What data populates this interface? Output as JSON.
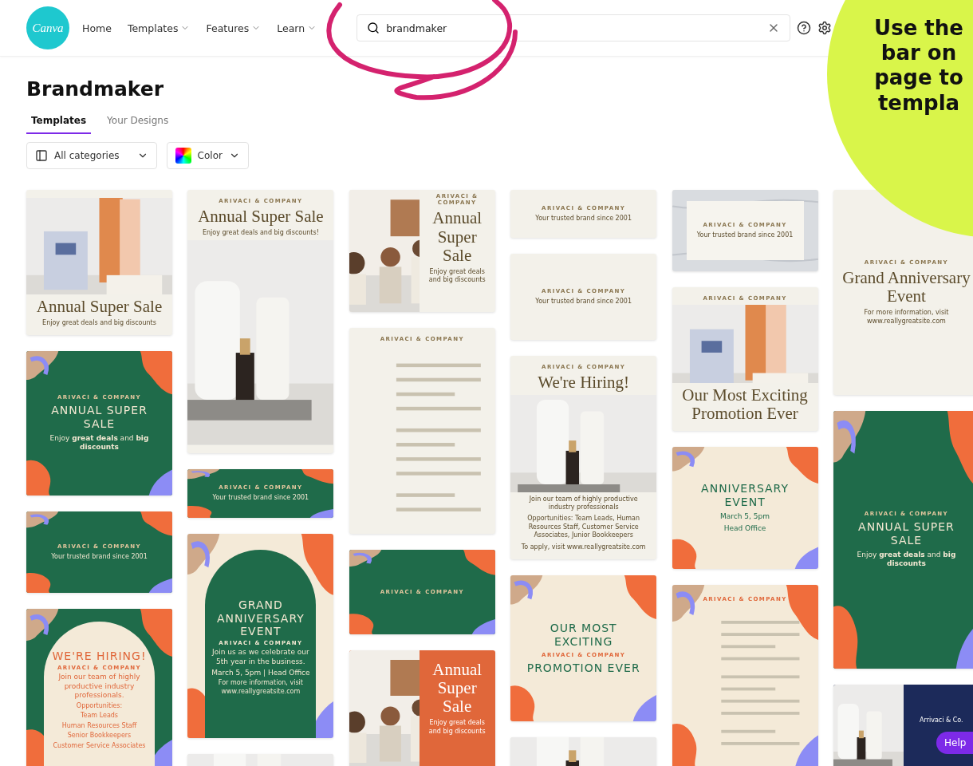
{
  "nav": {
    "logo": "Canva",
    "links": [
      {
        "label": "Home",
        "dropdown": false
      },
      {
        "label": "Templates",
        "dropdown": true
      },
      {
        "label": "Features",
        "dropdown": true
      },
      {
        "label": "Learn",
        "dropdown": true
      }
    ],
    "search": {
      "value": "brandmaker"
    }
  },
  "page": {
    "title": "Brandmaker",
    "tabs": [
      {
        "label": "Templates",
        "selected": true
      },
      {
        "label": "Your Designs",
        "selected": false
      }
    ],
    "filters": [
      {
        "kind": "category",
        "label": "All categories"
      },
      {
        "kind": "color",
        "label": "Color"
      }
    ]
  },
  "columns": [
    [
      {
        "kind": "plain",
        "color": "#f3f1ea",
        "content": [
          {
            "kind": "picture"
          },
          {
            "kind": "title",
            "text": "Annual Super Sale"
          },
          {
            "kind": "body",
            "text": "Enjoy great deals and big discounts"
          }
        ]
      },
      {
        "kind": "blobs",
        "color": "#1f6b4a",
        "content": [
          {
            "kind": "brand",
            "text": "ARIVACI & COMPANY"
          },
          {
            "kind": "arc",
            "text": "ANNUAL SUPER SALE"
          },
          {
            "kind": "subtitle",
            "text": "Enjoy **great deals** and **big discounts**"
          }
        ]
      },
      {
        "kind": "blobs",
        "color": "#1f6b4a",
        "content": [
          {
            "kind": "brand",
            "text": "ARIVACI & COMPANY"
          },
          {
            "kind": "body",
            "text": "Your trusted brand since 2001"
          }
        ]
      },
      {
        "kind": "arch",
        "color": "#1f6b4a",
        "content": [
          {
            "kind": "arc",
            "text": "WE'RE HIRING!"
          },
          {
            "kind": "brand",
            "text": "ARIVACI & COMPANY"
          },
          {
            "kind": "subtitle",
            "text": "Join our team of highly productive industry professionals."
          },
          {
            "kind": "body",
            "text": "Opportunities:"
          },
          {
            "kind": "body",
            "text": "Team Leads"
          },
          {
            "kind": "body",
            "text": "Human Resources Staff"
          },
          {
            "kind": "body",
            "text": "Senior Bookkeepers"
          },
          {
            "kind": "body",
            "text": "Customer Service Associates"
          }
        ]
      }
    ],
    [
      {
        "kind": "plain",
        "color": "#f3f1ea",
        "content": [
          {
            "kind": "brand",
            "text": "ARIVACI & COMPANY"
          },
          {
            "kind": "title",
            "text": "Annual Super Sale"
          },
          {
            "kind": "body",
            "text": "Enjoy great deals and big discounts!"
          },
          {
            "kind": "picture"
          }
        ]
      },
      {
        "kind": "blobs",
        "color": "#1f6b4a",
        "content": [
          {
            "kind": "brand",
            "text": "ARIVACI & COMPANY"
          },
          {
            "kind": "body",
            "text": "Your trusted brand since 2001"
          }
        ]
      },
      {
        "kind": "arch",
        "color": "#f4ead8",
        "content": [
          {
            "kind": "arc",
            "text": "GRAND ANNIVERSARY EVENT"
          },
          {
            "kind": "brand",
            "text": "ARIVACI & COMPANY"
          },
          {
            "kind": "subtitle",
            "text": "Join us as we celebrate our 5th year in the business."
          },
          {
            "kind": "subtitle",
            "text": "March 5, 5pm | Head Office"
          },
          {
            "kind": "body",
            "text": "For more information, visit www.reallygreatsite.com"
          }
        ]
      },
      {
        "content": [
          {
            "kind": "picture"
          }
        ]
      }
    ],
    [
      {
        "kind": "sidephoto",
        "color": "#f3f1ea",
        "content": [
          {
            "kind": "brand",
            "text": "ARIVACI & COMPANY"
          },
          {
            "kind": "title",
            "text": "Annual Super Sale"
          },
          {
            "kind": "body",
            "text": "Enjoy great deals and big discounts"
          }
        ]
      },
      {
        "kind": "plain",
        "color": "#f3f1ea",
        "content": [
          {
            "kind": "brand",
            "text": "ARIVACI & COMPANY"
          },
          {
            "kind": "lines"
          }
        ]
      },
      {
        "kind": "blobs",
        "color": "#1f6b4a",
        "content": [
          {
            "kind": "brand",
            "text": "ARIVACI & COMPANY"
          }
        ]
      },
      {
        "kind": "sidephoto",
        "color": "#e0673a",
        "content": [
          {
            "kind": "title",
            "text": "Annual Super Sale"
          },
          {
            "kind": "body",
            "text": "Enjoy great deals and big discounts"
          }
        ]
      }
    ],
    [
      {
        "kind": "plain",
        "color": "#f3f1ea",
        "content": [
          {
            "kind": "brand",
            "text": "ARIVACI & COMPANY"
          },
          {
            "kind": "body",
            "text": "Your trusted brand since 2001"
          }
        ]
      },
      {
        "kind": "plain",
        "color": "#f3f1ea",
        "content": [
          {
            "kind": "brand",
            "text": "ARIVACI & COMPANY"
          },
          {
            "kind": "body",
            "text": "Your trusted brand since 2001"
          }
        ]
      },
      {
        "kind": "plain",
        "color": "#f3f1ea",
        "content": [
          {
            "kind": "brand",
            "text": "ARIVACI & COMPANY"
          },
          {
            "kind": "title",
            "text": "We're Hiring!"
          },
          {
            "kind": "picture"
          },
          {
            "kind": "body",
            "text": "Join our team of highly productive industry professionals"
          },
          {
            "kind": "body",
            "text": "Opportunities: Team Leads, Human Resources Staff, Customer Service Associates, Junior Bookkeepers"
          },
          {
            "kind": "body",
            "text": "To apply, visit www.reallygreatsite.com"
          }
        ]
      },
      {
        "kind": "blobs",
        "color": "#f4ead8",
        "content": [
          {
            "kind": "arc",
            "text": "OUR MOST EXCITING"
          },
          {
            "kind": "brand",
            "text": "ARIVACI & COMPANY"
          },
          {
            "kind": "arc",
            "text": "PROMOTION EVER"
          }
        ]
      },
      {
        "content": [
          {
            "kind": "picture"
          }
        ]
      }
    ],
    [
      {
        "kind": "marble",
        "color": "#f3f1ea",
        "content": [
          {
            "kind": "brand",
            "text": "ARIVACI & COMPANY"
          },
          {
            "kind": "body",
            "text": "Your trusted brand since 2001"
          }
        ]
      },
      {
        "kind": "plain",
        "color": "#f3f1ea",
        "content": [
          {
            "kind": "brand",
            "text": "ARIVACI & COMPANY"
          },
          {
            "kind": "picture"
          },
          {
            "kind": "title",
            "text": "Our Most Exciting Promotion Ever"
          }
        ]
      },
      {
        "kind": "blobs",
        "color": "#f4ead8",
        "content": [
          {
            "kind": "arc",
            "text": "ANNIVERSARY EVENT"
          },
          {
            "kind": "subtitle",
            "text": "March 5, 5pm"
          },
          {
            "kind": "subtitle",
            "text": "Head Office"
          }
        ]
      },
      {
        "kind": "blobs",
        "color": "#f4ead8",
        "content": [
          {
            "kind": "brand",
            "text": "ARIVACI & COMPANY"
          },
          {
            "kind": "lines"
          }
        ]
      }
    ],
    [
      {
        "kind": "plain",
        "color": "#f3f1ea",
        "content": [
          {
            "kind": "brand",
            "text": "ARIVACI & COMPANY"
          },
          {
            "kind": "title",
            "text": "Grand Anniversary Event"
          },
          {
            "kind": "body",
            "text": "For more information, visit www.reallygreatsite.com"
          }
        ]
      },
      {
        "kind": "blobs",
        "color": "#1f6b4a",
        "content": [
          {
            "kind": "brand",
            "text": "ARIVACI & COMPANY"
          },
          {
            "kind": "arc",
            "text": "ANNUAL SUPER SALE"
          },
          {
            "kind": "subtitle",
            "text": "Enjoy **great deals** and **big discounts**"
          }
        ]
      },
      {
        "kind": "sidephoto",
        "color": "#1c2a5a",
        "content": [
          {
            "kind": "body",
            "text": "Arrivaci & Co."
          }
        ]
      }
    ]
  ],
  "callout": {
    "lines": [
      "Use the",
      "bar on",
      "page to",
      "templa"
    ]
  },
  "help_button": {
    "label": "Help"
  }
}
